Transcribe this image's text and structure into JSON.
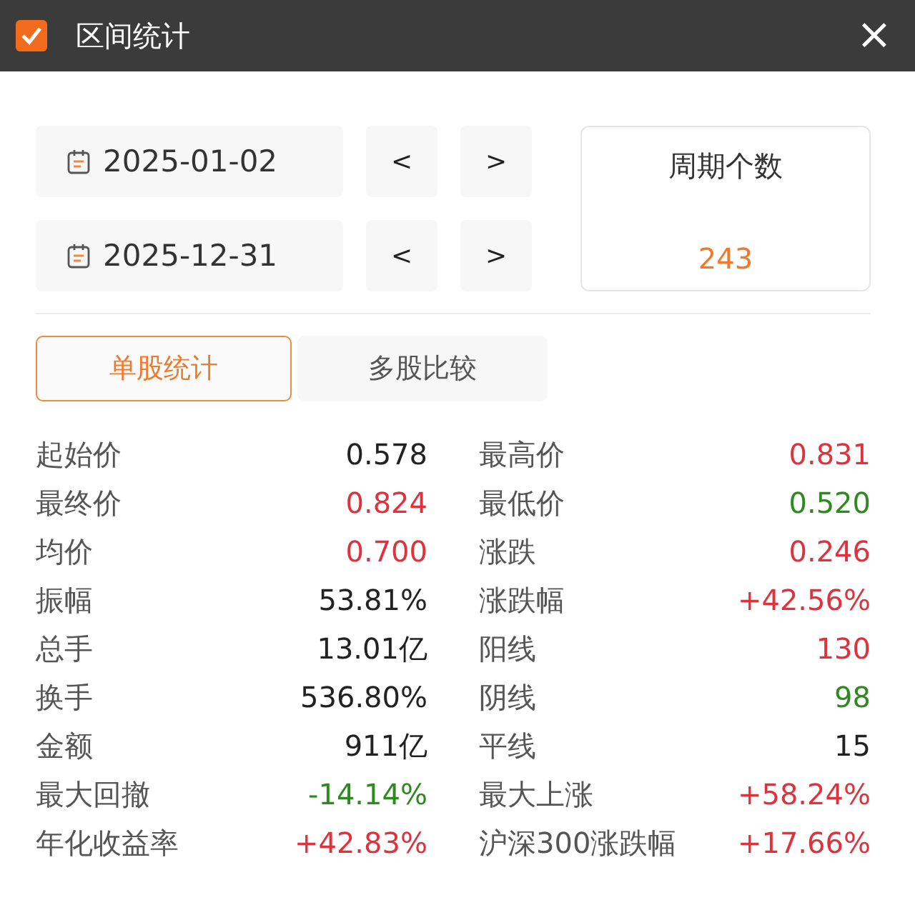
{
  "window": {
    "title": "区间统计",
    "close": "×"
  },
  "dates": [
    {
      "value": "2025-01-02",
      "prev": "<",
      "next": ">"
    },
    {
      "value": "2025-12-31",
      "prev": "<",
      "next": ">"
    }
  ],
  "period": {
    "label": "周期个数",
    "value": "243"
  },
  "tabs": [
    {
      "label": "单股统计",
      "selected": true
    },
    {
      "label": "多股比较",
      "selected": false
    }
  ],
  "stats": [
    {
      "label": "起始价",
      "value": "0.578",
      "color": "#222222"
    },
    {
      "label": "最高价",
      "value": "0.831",
      "color": "#e0323c"
    },
    {
      "label": "最终价",
      "value": "0.824",
      "color": "#e0323c"
    },
    {
      "label": "最低价",
      "value": "0.520",
      "color": "#2d8a1e"
    },
    {
      "label": "均价",
      "value": "0.700",
      "color": "#e0323c"
    },
    {
      "label": "涨跌",
      "value": "0.246",
      "color": "#e0323c"
    },
    {
      "label": "振幅",
      "value": "53.81%",
      "color": "#222222"
    },
    {
      "label": "涨跌幅",
      "value": "+42.56%",
      "color": "#e0323c"
    },
    {
      "label": "总手",
      "value": "13.01亿",
      "color": "#222222"
    },
    {
      "label": "阳线",
      "value": "130",
      "color": "#e0323c"
    },
    {
      "label": "换手",
      "value": "536.80%",
      "color": "#222222"
    },
    {
      "label": "阴线",
      "value": "98",
      "color": "#2d8a1e"
    },
    {
      "label": "金额",
      "value": "911亿",
      "color": "#222222"
    },
    {
      "label": "平线",
      "value": "15",
      "color": "#222222"
    },
    {
      "label": "最大回撤",
      "value": "-14.14%",
      "color": "#2d8a1e"
    },
    {
      "label": "最大上涨",
      "value": "+58.24%",
      "color": "#e0323c"
    },
    {
      "label": "年化收益率",
      "value": "+42.83%",
      "color": "#e0323c"
    },
    {
      "label": "沪深300涨跌幅",
      "value": "+17.66%",
      "color": "#e0323c"
    }
  ]
}
